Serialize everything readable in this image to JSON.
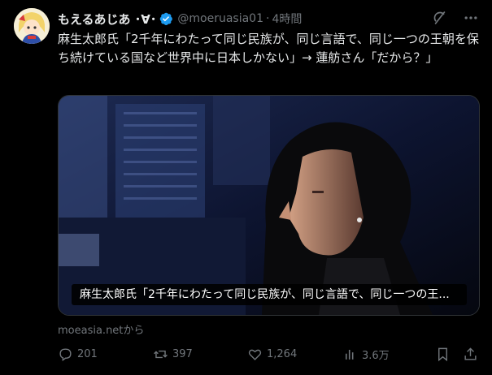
{
  "tweet": {
    "author_name": "もえるあじあ ･∀･",
    "handle": "@moeruasia01",
    "separator": "·",
    "time": "4時間",
    "text": "麻生太郎氏「2千年にわたって同じ民族が、同じ言語で、同じ一つの王朝を保ち続けている国など世界中に日本しかない」→ 蓮舫さん「だから？」",
    "media_caption": "麻生太郎氏「2千年にわたって同じ民族が、同じ言語で、同じ一つの王...",
    "source": "moeasia.netから"
  },
  "actions": {
    "replies": "201",
    "reposts": "397",
    "likes": "1,264",
    "views": "3.6万"
  },
  "icons": {
    "verified": "verified-badge-icon",
    "grok": "grok-icon",
    "more": "more-icon",
    "reply": "reply-icon",
    "repost": "repost-icon",
    "like": "heart-icon",
    "views": "views-icon",
    "bookmark": "bookmark-icon",
    "share": "share-icon"
  },
  "colors": {
    "background": "#000000",
    "text": "#e7e9ea",
    "muted": "#71767b",
    "verified": "#1d9bf0",
    "border": "#2f3336"
  }
}
